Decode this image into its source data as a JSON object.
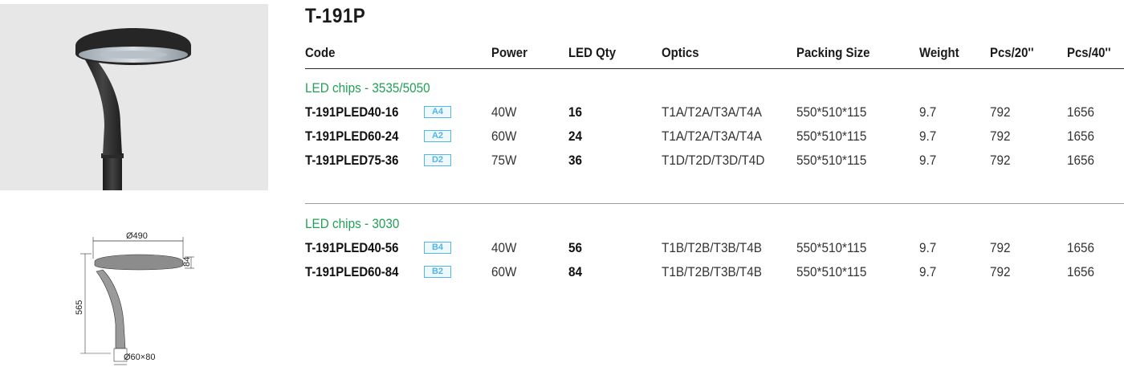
{
  "product": {
    "title": "T-191P"
  },
  "headers": {
    "code": "Code",
    "power": "Power",
    "led_qty": "LED Qty",
    "optics": "Optics",
    "packing_size": "Packing Size",
    "weight": "Weight",
    "pcs20": "Pcs/20''",
    "pcs40": "Pcs/40''"
  },
  "groups": [
    {
      "label": "LED chips - 3535/5050",
      "rows": [
        {
          "code": "T-191PLED40-16",
          "badge": "A4",
          "power": "40W",
          "qty": "16",
          "optics": "T1A/T2A/T3A/T4A",
          "packing": "550*510*115",
          "weight": "9.7",
          "pcs20": "792",
          "pcs40": "1656"
        },
        {
          "code": "T-191PLED60-24",
          "badge": "A2",
          "power": "60W",
          "qty": "24",
          "optics": "T1A/T2A/T3A/T4A",
          "packing": "550*510*115",
          "weight": "9.7",
          "pcs20": "792",
          "pcs40": "1656"
        },
        {
          "code": "T-191PLED75-36",
          "badge": "D2",
          "power": "75W",
          "qty": "36",
          "optics": "T1D/T2D/T3D/T4D",
          "packing": "550*510*115",
          "weight": "9.7",
          "pcs20": "792",
          "pcs40": "1656"
        }
      ]
    },
    {
      "label": "LED chips - 3030",
      "rows": [
        {
          "code": "T-191PLED40-56",
          "badge": "B4",
          "power": "40W",
          "qty": "56",
          "optics": "T1B/T2B/T3B/T4B",
          "packing": "550*510*115",
          "weight": "9.7",
          "pcs20": "792",
          "pcs40": "1656"
        },
        {
          "code": "T-191PLED60-84",
          "badge": "B2",
          "power": "60W",
          "qty": "84",
          "optics": "T1B/T2B/T3B/T4B",
          "packing": "550*510*115",
          "weight": "9.7",
          "pcs20": "792",
          "pcs40": "1656"
        }
      ]
    }
  ],
  "drawing": {
    "width_label": "Ø490",
    "height_label": "565",
    "head_label": "84",
    "base_label": "Ø60×80"
  },
  "colors": {
    "group_label": "#22a057",
    "badge_border": "#54b6e3",
    "photo_bg": "#e7e7e7"
  }
}
